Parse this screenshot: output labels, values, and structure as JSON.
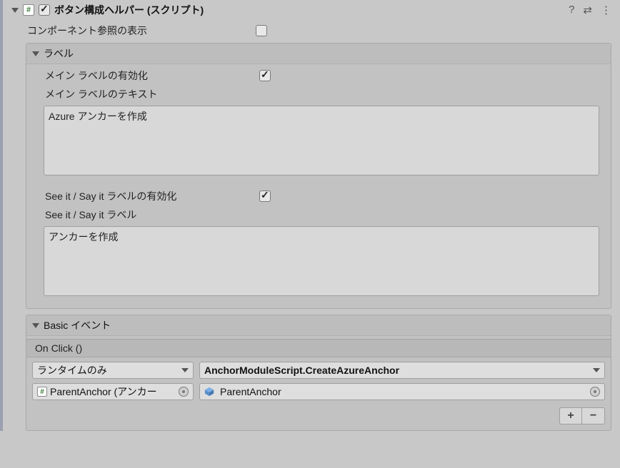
{
  "component": {
    "title": "ボタン構成ヘルパー (スクリプト)",
    "script_icon_glyph": "#",
    "enabled": true,
    "show_component_refs_label": "コンポーネント参照の表示",
    "show_component_refs_value": false
  },
  "section_label": {
    "header": "ラベル",
    "main_enable_label": "メイン ラベルの有効化",
    "main_enable_value": true,
    "main_text_label": "メイン ラベルのテキスト",
    "main_text_value": "Azure アンカーを作成",
    "seeit_enable_label": "See it / Say it ラベルの有効化",
    "seeit_enable_value": true,
    "seeit_text_label": "See it / Say it ラベル",
    "seeit_text_value": "アンカーを作成"
  },
  "section_events": {
    "header": "Basic イベント",
    "onclick_label": "On Click ()",
    "runtime_mode": "ランタイムのみ",
    "method": "AnchorModuleScript.CreateAzureAnchor",
    "target_obj": "ParentAnchor (アンカー",
    "argument_obj": "ParentAnchor",
    "add_glyph": "+",
    "remove_glyph": "−"
  },
  "header_icons": {
    "help": "?",
    "preset": "⇄",
    "menu": "⋮"
  }
}
